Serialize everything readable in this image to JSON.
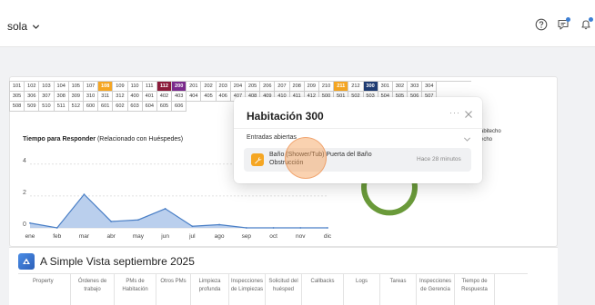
{
  "header": {
    "workspace": "sola"
  },
  "rooms": {
    "rows": [
      [
        {
          "n": "101"
        },
        {
          "n": "102"
        },
        {
          "n": "103"
        },
        {
          "n": "104"
        },
        {
          "n": "105"
        },
        {
          "n": "107"
        },
        {
          "n": "108",
          "s": "orange"
        },
        {
          "n": "109"
        },
        {
          "n": "110"
        },
        {
          "n": "111"
        },
        {
          "n": "112",
          "s": "maroon"
        },
        {
          "n": "200",
          "s": "purple"
        },
        {
          "n": "201"
        },
        {
          "n": "202"
        },
        {
          "n": "203"
        },
        {
          "n": "204"
        },
        {
          "n": "205"
        },
        {
          "n": "206"
        },
        {
          "n": "207"
        },
        {
          "n": "208"
        },
        {
          "n": "209"
        },
        {
          "n": "210"
        },
        {
          "n": "211",
          "s": "orange"
        },
        {
          "n": "212"
        },
        {
          "n": "300",
          "s": "navy"
        },
        {
          "n": "301"
        },
        {
          "n": "302"
        },
        {
          "n": "303"
        },
        {
          "n": "304"
        }
      ],
      [
        {
          "n": "305"
        },
        {
          "n": "306"
        },
        {
          "n": "307"
        },
        {
          "n": "308"
        },
        {
          "n": "309"
        },
        {
          "n": "310"
        },
        {
          "n": "311"
        },
        {
          "n": "312"
        },
        {
          "n": "400"
        },
        {
          "n": "401"
        },
        {
          "n": "402"
        },
        {
          "n": "403"
        },
        {
          "n": "404"
        },
        {
          "n": "405"
        },
        {
          "n": "406"
        },
        {
          "n": "407"
        },
        {
          "n": "408"
        },
        {
          "n": "409"
        },
        {
          "n": "410"
        },
        {
          "n": "411"
        },
        {
          "n": "412"
        },
        {
          "n": "500"
        },
        {
          "n": "501"
        },
        {
          "n": "502"
        },
        {
          "n": "503"
        },
        {
          "n": "504"
        },
        {
          "n": "505"
        },
        {
          "n": "506"
        },
        {
          "n": "507"
        }
      ],
      [
        {
          "n": "508"
        },
        {
          "n": "509"
        },
        {
          "n": "510"
        },
        {
          "n": "511"
        },
        {
          "n": "512"
        },
        {
          "n": "600"
        },
        {
          "n": "601"
        },
        {
          "n": "602"
        },
        {
          "n": "603"
        },
        {
          "n": "604"
        },
        {
          "n": "605"
        },
        {
          "n": "606"
        }
      ]
    ]
  },
  "response_chart": {
    "title_bold": "Tiempo para Responder",
    "title_rest": " (Relacionado con Huéspedes)"
  },
  "chart_data": {
    "type": "area",
    "categories": [
      "ene",
      "feb",
      "mar",
      "abr",
      "may",
      "jun",
      "jul",
      "ago",
      "sep",
      "oct",
      "nov",
      "dic"
    ],
    "values": [
      0.3,
      0.0,
      2.1,
      0.4,
      0.5,
      1.2,
      0.1,
      0.2,
      0.0,
      0.0,
      0.0,
      0.0
    ],
    "y_ticks": [
      "4",
      "2",
      "0"
    ],
    "ylim": [
      0,
      4.5
    ],
    "fill_color": "#a9c3e8",
    "line_color": "#4a7fc6",
    "grid": true
  },
  "side": {
    "label1": "abitecho",
    "label2": "echo"
  },
  "bottom": {
    "title": "A Simple Vista septiembre 2025",
    "columns": [
      "Property",
      "Órdenes de trabajo",
      "PMs de Habitación",
      "Otros PMs",
      "Limpieza profunda",
      "Inspecciones de Limpiezas",
      "Solicitud del huésped",
      "Callbacks",
      "Logs",
      "Tareas",
      "Inspecciones de Gerencia",
      "Tiempo de Respuesta"
    ]
  },
  "popup": {
    "title": "Habitación 300",
    "more": "···",
    "section": "Entradas abiertas",
    "entry": {
      "line1": "Baño (Shower/Tub) Puerta del Baño",
      "line2": "Obstrucción",
      "time": "Hace 28 minutos"
    }
  },
  "colors": {
    "accent_orange": "#f5a623",
    "donut_green": "#6a9a3a",
    "donut_blue": "#2f6fd0"
  }
}
